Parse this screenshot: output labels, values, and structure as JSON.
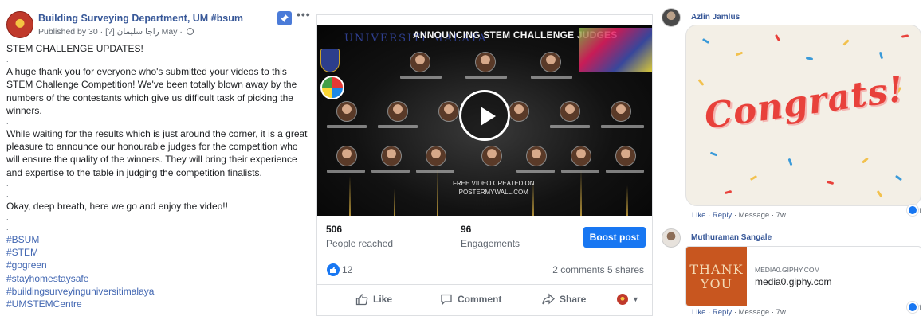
{
  "post": {
    "page_name": "Building Surveying Department, UM #bsum",
    "publisher_prefix": "Published by ",
    "publisher_name": "راجا سليمان",
    "publisher_suffix": " [?] · 30 May · ",
    "headline": "STEM CHALLENGE UPDATES!",
    "paragraph_1": "A huge thank you for everyone who's submitted your videos to this STEM Challenge Competition! We've been totally blown away by the numbers of the contestants which give us difficult task of picking the winners.",
    "paragraph_2": "While waiting for the results which is just around the corner, it is a great pleasure to announce our honourable judges for the competition who will ensure the quality of the winners. They will bring their experience and expertise to the table in judging the competition finalists.",
    "paragraph_3": "Okay, deep breath, here we go and enjoy the video!!",
    "separator": ".",
    "hashtags": [
      "#BSUM",
      "#STEM",
      "#gogreen",
      "#stayhomestaysafe",
      "#buildingsurveyinguniversitimalaya",
      "#UMSTEMCentre"
    ],
    "icons": {
      "pin": "pin-icon",
      "more": "more-options-icon",
      "audience": "globe-icon"
    }
  },
  "video": {
    "poster_title": "ANNOUNCING STEM CHALLENGE  JUDGES",
    "university_logo_text": "UNIVERSITI MALAYA",
    "footer_line_1": "FREE VIDEO CREATED ON",
    "footer_line_2": "POSTERMYWALL.COM",
    "icons": {
      "play": "play-icon"
    }
  },
  "stats": {
    "reached_value": "506",
    "reached_label": "People reached",
    "engagements_value": "96",
    "engagements_label": "Engagements",
    "boost_label": "Boost post",
    "reactions_count": "12",
    "comments_shares": "2 comments  5 shares"
  },
  "actions": {
    "like_label": "Like",
    "comment_label": "Comment",
    "share_label": "Share",
    "icons": {
      "like": "thumbs-up-icon",
      "comment": "comment-bubble-icon",
      "share": "share-arrow-icon",
      "profile_caret": "chevron-down-icon"
    }
  },
  "comments": [
    {
      "author": "Azlin Jamlus",
      "gif_text": "Congrats!",
      "meta_like": "Like",
      "meta_reply": "Reply",
      "meta_message": "Message",
      "meta_time": "7w",
      "meta_dot": " · ",
      "reaction_count": "1"
    },
    {
      "author": "Muthuraman Sangale",
      "link_tile_text": "THANK YOU",
      "link_domain": "MEDIA0.GIPHY.COM",
      "link_title": "media0.giphy.com",
      "meta_like": "Like",
      "meta_reply": "Reply",
      "meta_message": "Message",
      "meta_time": "7w",
      "meta_dot": " · ",
      "reaction_count": "1"
    }
  ],
  "colors": {
    "link_blue": "#385898",
    "hashtag_blue": "#4267b2",
    "boost_blue": "#1877f2",
    "congrats_red": "#e8413b",
    "thank_you_orange": "#c8561f"
  }
}
